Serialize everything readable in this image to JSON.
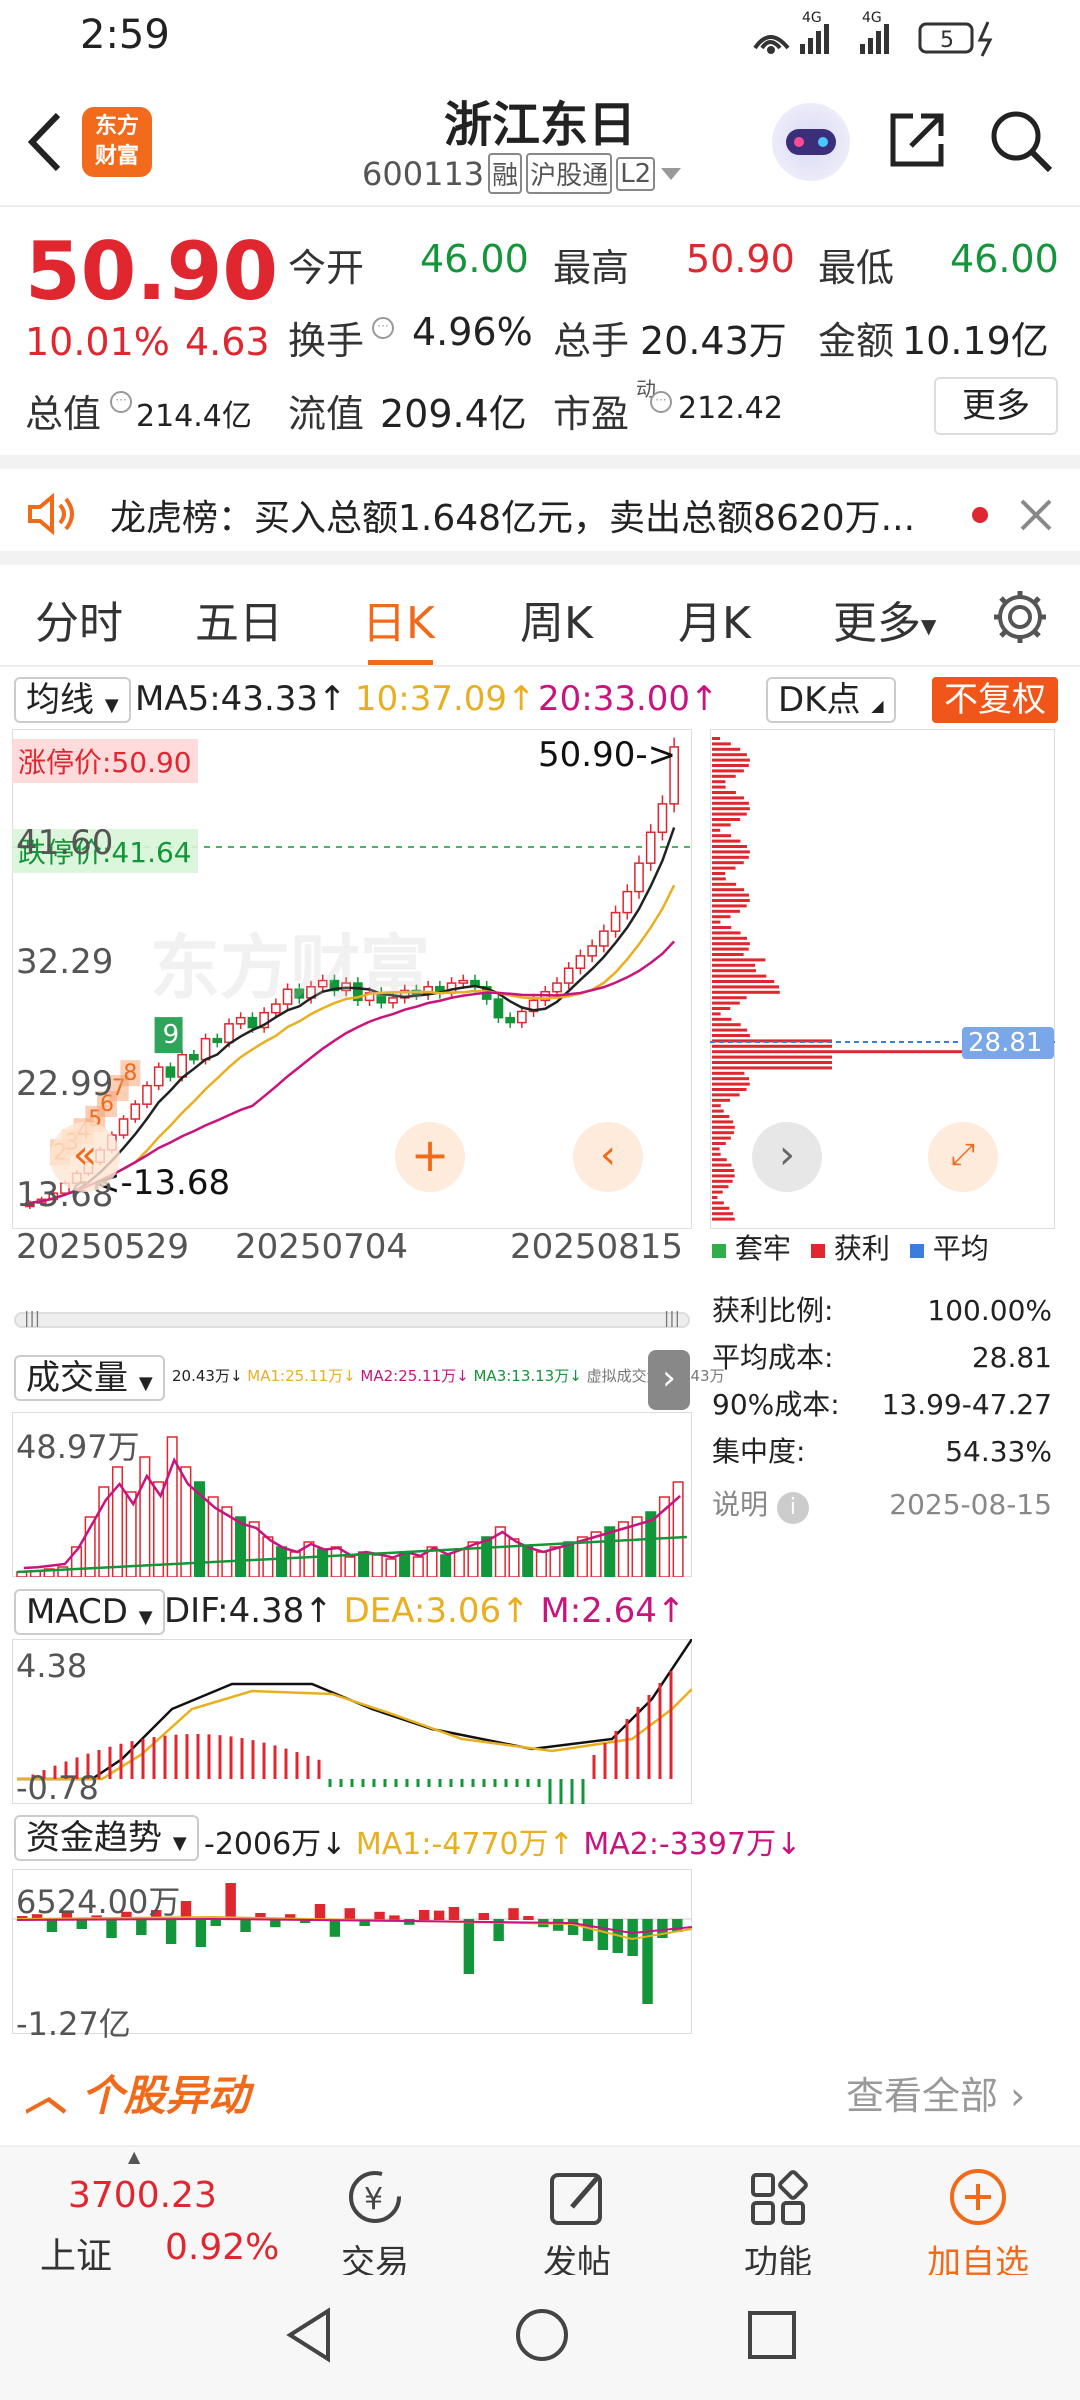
{
  "status": {
    "time": "2:59",
    "battery": "5",
    "net1": "4G",
    "net2": "4G"
  },
  "header": {
    "title": "浙江东日",
    "code": "600113",
    "tags": [
      "融",
      "沪股通",
      "L2"
    ],
    "logo_line1": "东方",
    "logo_line2": "财富"
  },
  "quote": {
    "price": "50.90",
    "pct": "10.01%",
    "change": "4.63",
    "row1": [
      {
        "k": "今开",
        "v": "46.00"
      },
      {
        "k": "最高",
        "v": "50.90"
      },
      {
        "k": "最低",
        "v": "46.00"
      }
    ],
    "row2": [
      {
        "k": "换手",
        "v": "4.96%"
      },
      {
        "k": "总手",
        "v": "20.43万"
      },
      {
        "k": "金额",
        "v": "10.19亿"
      }
    ],
    "row3": [
      {
        "k": "总值",
        "v": "214.4亿"
      },
      {
        "k": "流值",
        "v": "209.4亿"
      },
      {
        "k": "市盈",
        "sup": "动",
        "v": "212.42"
      }
    ],
    "more": "更多"
  },
  "notice": {
    "text": "龙虎榜：买入总额1.648亿元，卖出总额8620万..."
  },
  "tabs": [
    "分时",
    "五日",
    "日K",
    "周K",
    "月K",
    "更多"
  ],
  "active_tab": "日K",
  "kline": {
    "indicator": "均线",
    "ma5": "MA5:43.33↑",
    "ma10": "10:37.09↑",
    "ma20": "20:33.00↑",
    "dk": "DK点",
    "fq": "不复权",
    "limit_up": "涨停价:50.90",
    "limit_down": "跌停价:41.64",
    "last_label": "50.90->",
    "low_label": "<-13.68",
    "y_ticks": [
      "50.90",
      "41.60",
      "32.29",
      "22.99",
      "13.68"
    ],
    "x_ticks": [
      "20250529",
      "20250704",
      "20250815"
    ],
    "watermark": "东方财富"
  },
  "chip": {
    "avg_label": "28.81",
    "legend": [
      "套牢",
      "获利",
      "平均"
    ],
    "stats": [
      {
        "k": "获利比例:",
        "v": "100.00%"
      },
      {
        "k": "平均成本:",
        "v": "28.81"
      },
      {
        "k": "90%成本:",
        "v": "13.99-47.27"
      },
      {
        "k": "集中度:",
        "v": "54.33%"
      }
    ],
    "note": "说明",
    "date": "2025-08-15"
  },
  "volume": {
    "label": "成交量",
    "vals": "20.43万↓",
    "ma1": "MA1:25.11万↓",
    "ma2": "MA2:25.11万↓",
    "ma3": "MA3:13.13万↓",
    "virt": "虚拟成交量:20.43万",
    "top": "48.97万"
  },
  "macd": {
    "label": "MACD",
    "dif": "DIF:4.38↑",
    "dea": "DEA:3.06↑",
    "m": "M:2.64↑",
    "top": "4.38",
    "bottom": "-0.78"
  },
  "fund": {
    "label": "资金趋势",
    "val": "-2006万↓",
    "ma1": "MA1:-4770万↑",
    "ma2": "MA2:-3397万↓",
    "top": "6524.00万",
    "bottom": "-1.27亿"
  },
  "section": {
    "title": "个股异动",
    "link": "查看全部"
  },
  "bottom": {
    "index_val": "3700.23",
    "index_name": "上证",
    "index_pct": "0.92%",
    "items": [
      "交易",
      "发帖",
      "功能",
      "加自选"
    ]
  },
  "colors": {
    "red": "#e0262f",
    "green": "#13953a",
    "orange": "#f06a1a",
    "ma5": "#222222",
    "ma10": "#e8b020",
    "ma20": "#c8147c"
  }
}
